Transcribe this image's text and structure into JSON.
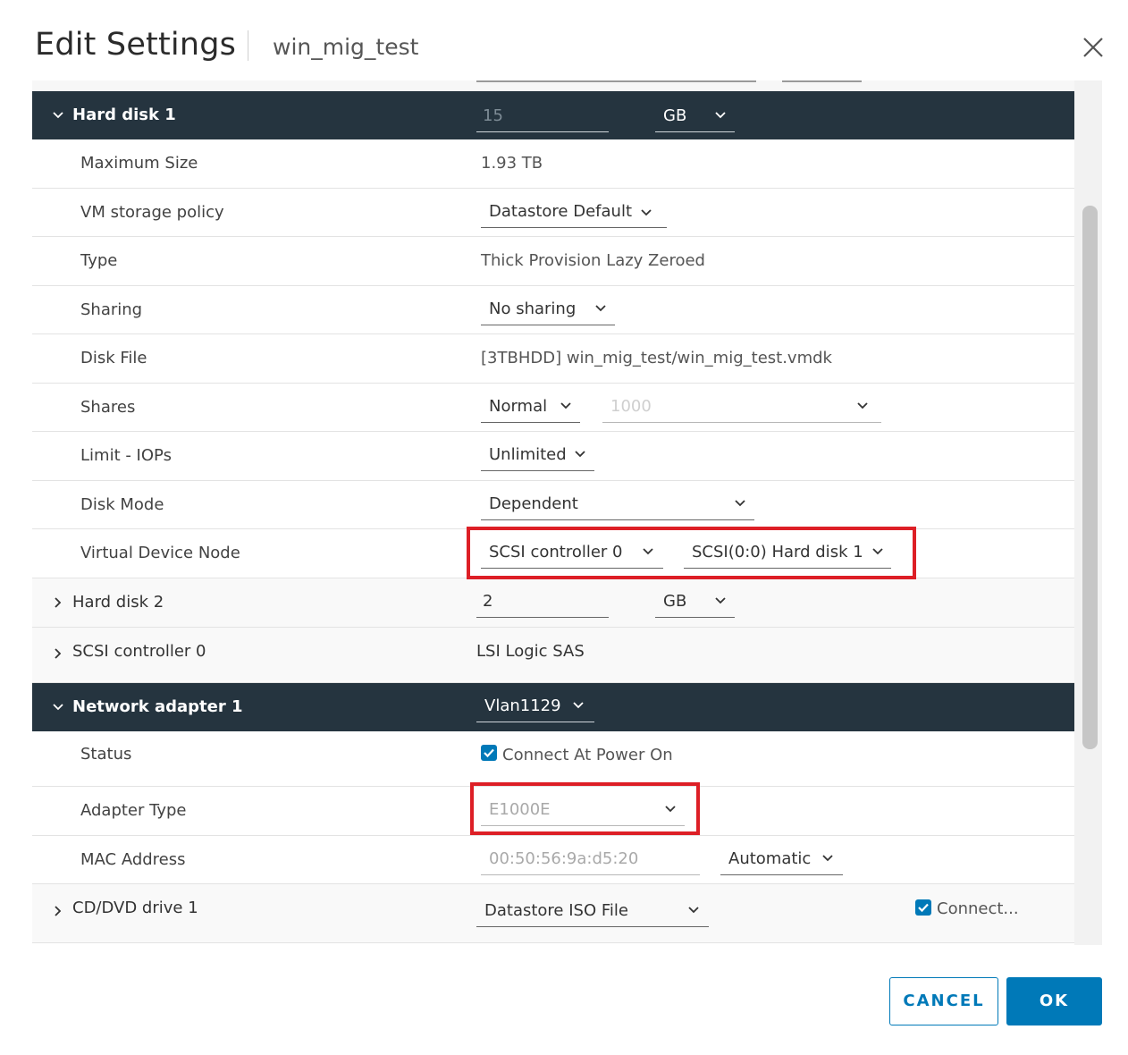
{
  "header": {
    "title": "Edit Settings",
    "vm_name": "win_mig_test"
  },
  "hard_disk_1": {
    "label": "Hard disk 1",
    "size_value": "15",
    "size_unit": "GB",
    "rows": {
      "max_size": {
        "label": "Maximum Size",
        "value": "1.93 TB"
      },
      "storage_policy": {
        "label": "VM storage policy",
        "value": "Datastore Default"
      },
      "type": {
        "label": "Type",
        "value": "Thick Provision Lazy Zeroed"
      },
      "sharing": {
        "label": "Sharing",
        "value": "No sharing"
      },
      "disk_file": {
        "label": "Disk File",
        "value": "[3TBHDD] win_mig_test/win_mig_test.vmdk"
      },
      "shares": {
        "label": "Shares",
        "value": "Normal",
        "amount": "1000"
      },
      "limit_iops": {
        "label": "Limit - IOPs",
        "value": "Unlimited"
      },
      "disk_mode": {
        "label": "Disk Mode",
        "value": "Dependent"
      },
      "virtual_device_node": {
        "label": "Virtual Device Node",
        "controller": "SCSI controller 0",
        "node": "SCSI(0:0) Hard disk 1"
      }
    }
  },
  "hard_disk_2": {
    "label": "Hard disk 2",
    "size_value": "2",
    "size_unit": "GB"
  },
  "scsi_controller_0": {
    "label": "SCSI controller 0",
    "value": "LSI Logic SAS"
  },
  "network_adapter_1": {
    "label": "Network adapter 1",
    "network": "Vlan1129",
    "rows": {
      "status": {
        "label": "Status",
        "checkbox_label": "Connect At Power On",
        "checked": true
      },
      "adapter_type": {
        "label": "Adapter Type",
        "value": "E1000E"
      },
      "mac_address": {
        "label": "MAC Address",
        "value": "00:50:56:9a:d5:20",
        "mode": "Automatic"
      }
    }
  },
  "cd_dvd_drive_1": {
    "label": "CD/DVD drive 1",
    "value": "Datastore ISO File",
    "connect_label": "Connect...",
    "connected": true
  },
  "footer": {
    "cancel_label": "CANCEL",
    "ok_label": "OK"
  },
  "colors": {
    "section_header_bg": "#25343f",
    "primary_blue": "#0079b8",
    "highlight_red": "#dd1f26"
  }
}
